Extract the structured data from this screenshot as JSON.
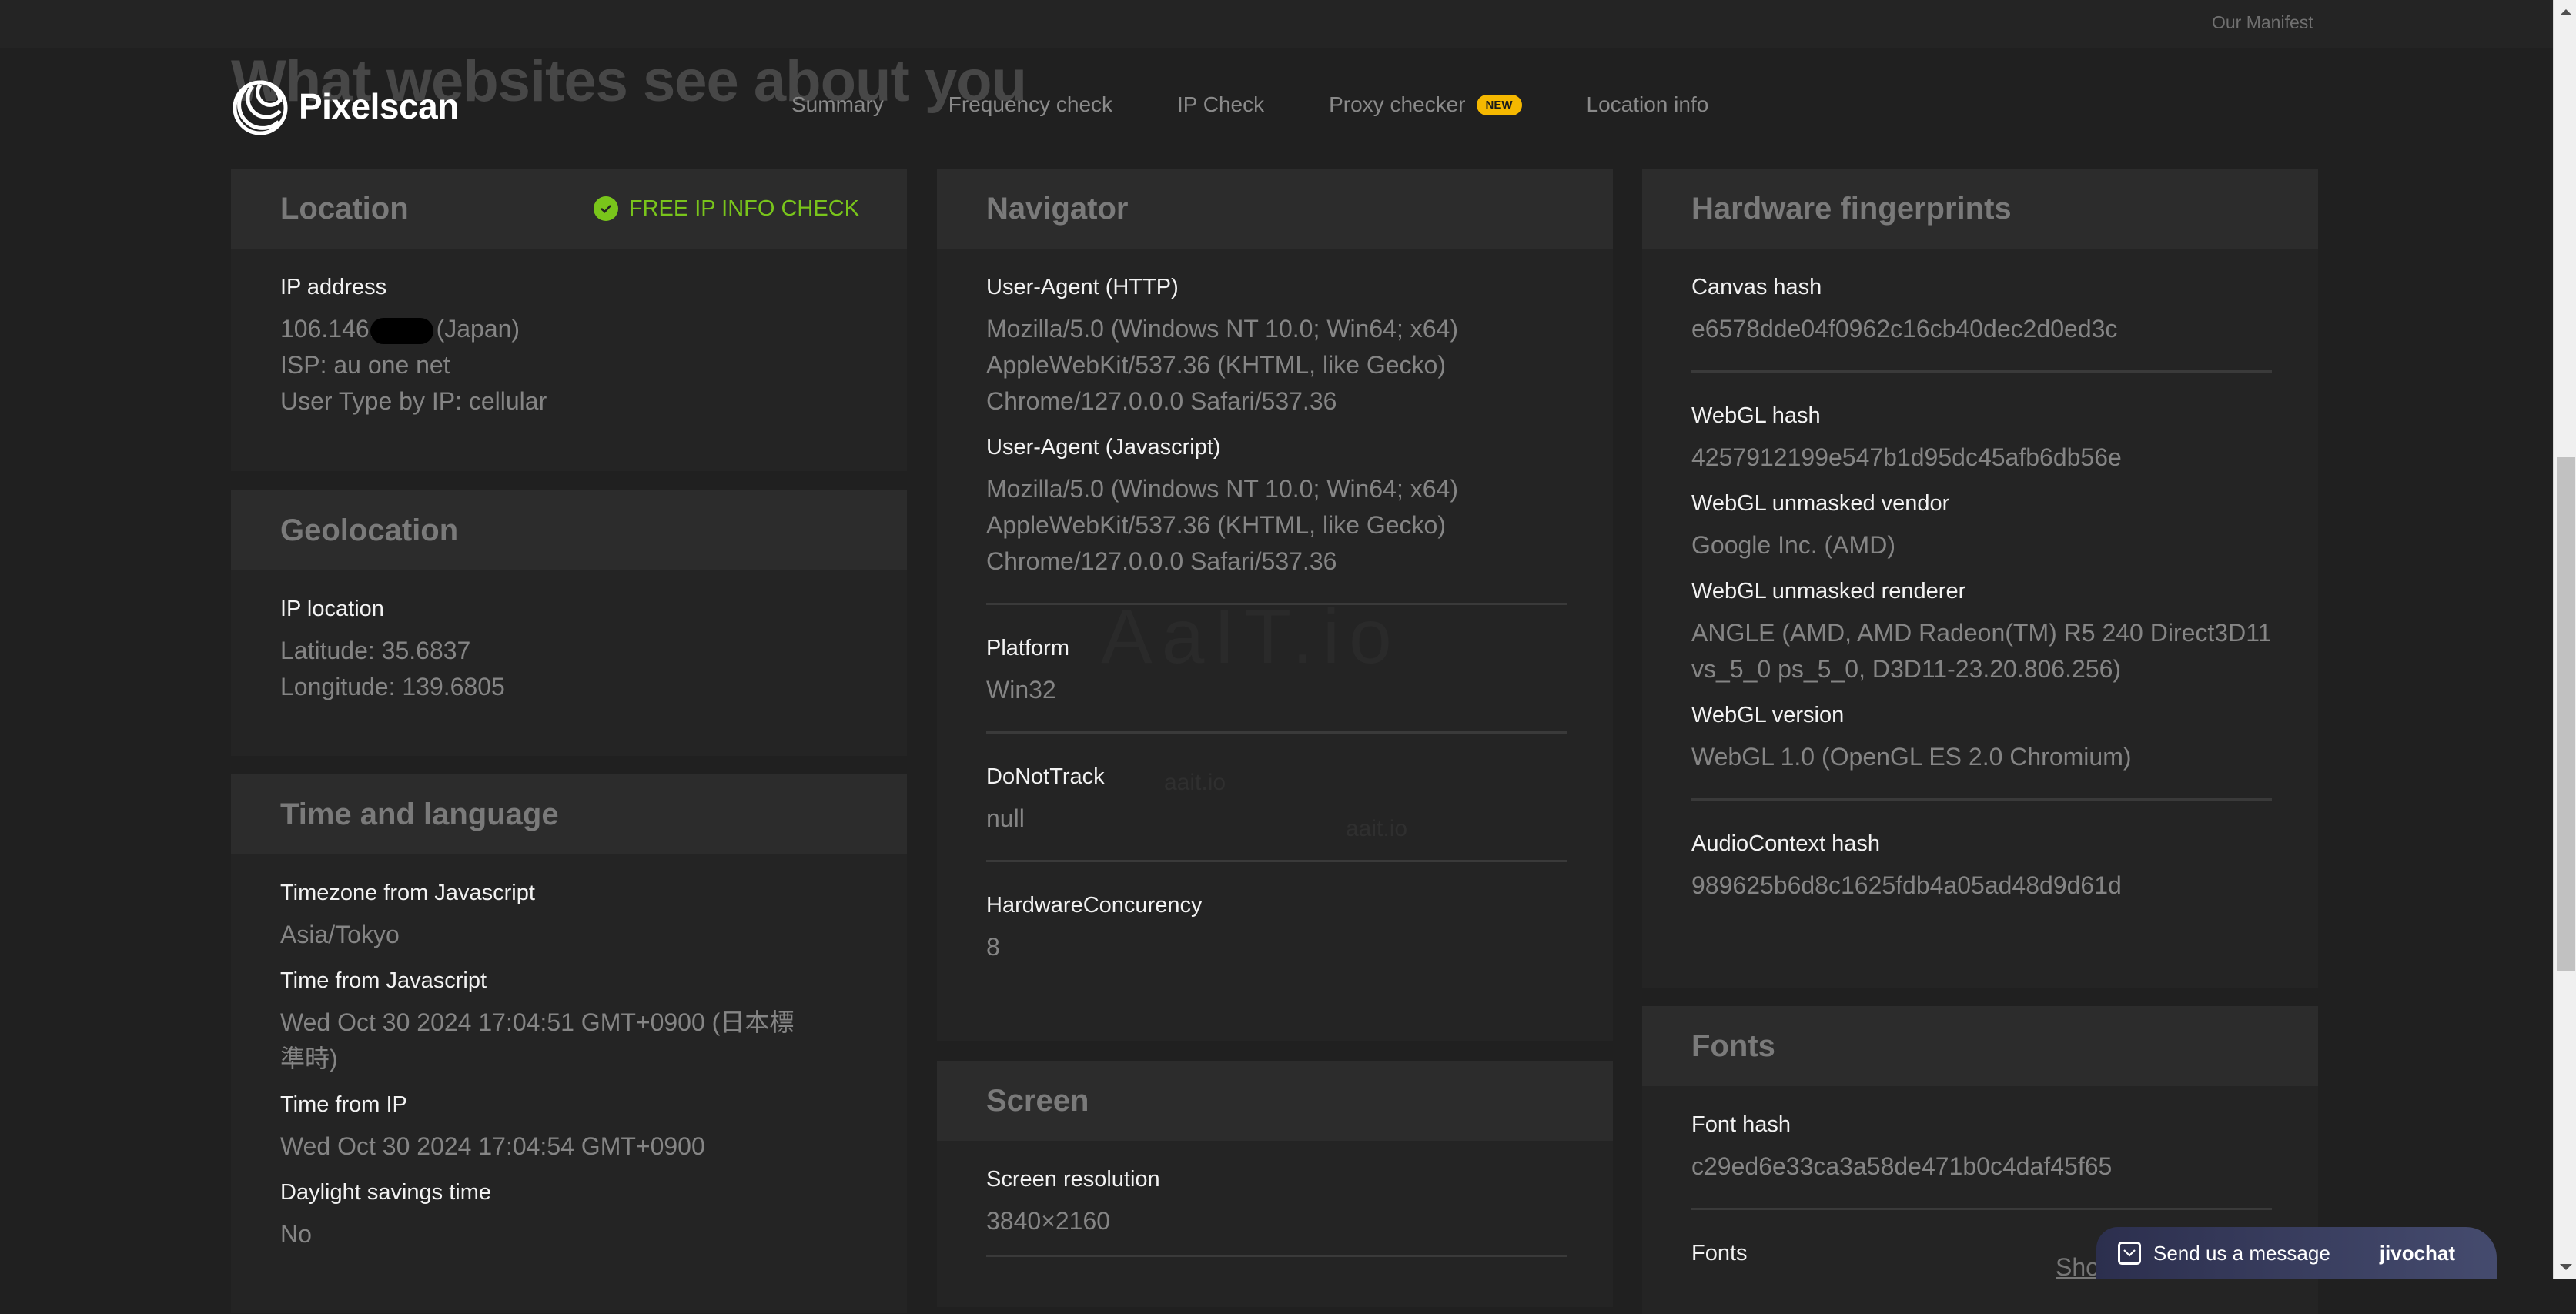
{
  "topbar": {
    "manifest_link": "Our Manifest"
  },
  "hero": {
    "title": "What websites see about you"
  },
  "brand": {
    "name": "Pixelscan"
  },
  "nav": {
    "items": [
      {
        "label": "Summary"
      },
      {
        "label": "Frequency check"
      },
      {
        "label": "IP Check"
      },
      {
        "label": "Proxy checker",
        "badge": "NEW"
      },
      {
        "label": "Location info"
      }
    ],
    "badge_color": "#f5b800"
  },
  "location": {
    "title": "Location",
    "free_check": "FREE IP INFO CHECK",
    "free_check_color": "#79c51b",
    "ip_label": "IP address",
    "ip_prefix": "106.146.",
    "ip_country": "(Japan)",
    "isp": "ISP: au one net",
    "user_type": "User Type by IP: cellular"
  },
  "geolocation": {
    "title": "Geolocation",
    "label": "IP location",
    "latitude": "Latitude: 35.6837",
    "longitude": "Longitude: 139.6805"
  },
  "time_language": {
    "title": "Time and language",
    "fields": [
      {
        "label": "Timezone from Javascript",
        "value": "Asia/Tokyo"
      },
      {
        "label": "Time from Javascript",
        "value": "Wed Oct 30 2024 17:04:51 GMT+0900 (日本標準時)"
      },
      {
        "label": "Time from IP",
        "value": "Wed Oct 30 2024 17:04:54 GMT+0900"
      },
      {
        "label": "Daylight savings time",
        "value": "No"
      }
    ]
  },
  "navigator": {
    "title": "Navigator",
    "fields": [
      {
        "label": "User-Agent (HTTP)",
        "value": "Mozilla/5.0 (Windows NT 10.0; Win64; x64) AppleWebKit/537.36 (KHTML, like Gecko) Chrome/127.0.0.0 Safari/537.36"
      },
      {
        "label": "User-Agent (Javascript)",
        "value": "Mozilla/5.0 (Windows NT 10.0; Win64; x64) AppleWebKit/537.36 (KHTML, like Gecko) Chrome/127.0.0.0 Safari/537.36"
      },
      {
        "label": "Platform",
        "value": "Win32"
      },
      {
        "label": "DoNotTrack",
        "value": "null"
      },
      {
        "label": "HardwareConcurency",
        "value": "8"
      }
    ],
    "watermark": "AaIT.io",
    "watermark_small": "aait.io"
  },
  "screen": {
    "title": "Screen",
    "fields": [
      {
        "label": "Screen resolution",
        "value": "3840×2160"
      }
    ]
  },
  "hardware": {
    "title": "Hardware fingerprints",
    "fields": [
      {
        "label": "Canvas hash",
        "value": "e6578dde04f0962c16cb40dec2d0ed3c"
      },
      {
        "label": "WebGL hash",
        "value": "4257912199e547b1d95dc45afb6db56e"
      },
      {
        "label": "WebGL unmasked vendor",
        "value": "Google Inc. (AMD)"
      },
      {
        "label": "WebGL unmasked renderer",
        "value": "ANGLE (AMD, AMD Radeon(TM) R5 240 Direct3D11 vs_5_0 ps_5_0, D3D11-23.20.806.256)"
      },
      {
        "label": "WebGL version",
        "value": "WebGL 1.0 (OpenGL ES 2.0 Chromium)"
      },
      {
        "label": "AudioContext hash",
        "value": "989625b6d8c1625fdb4a05ad48d9d61d"
      }
    ]
  },
  "fonts": {
    "title": "Fonts",
    "fields": [
      {
        "label": "Font hash",
        "value": "c29ed6e33ca3a58de471b0c4daf45f65"
      },
      {
        "label": "Fonts",
        "value": ""
      }
    ],
    "show_link": "Sho"
  },
  "chat": {
    "label": "Send us a message",
    "brand": "jivochat"
  }
}
